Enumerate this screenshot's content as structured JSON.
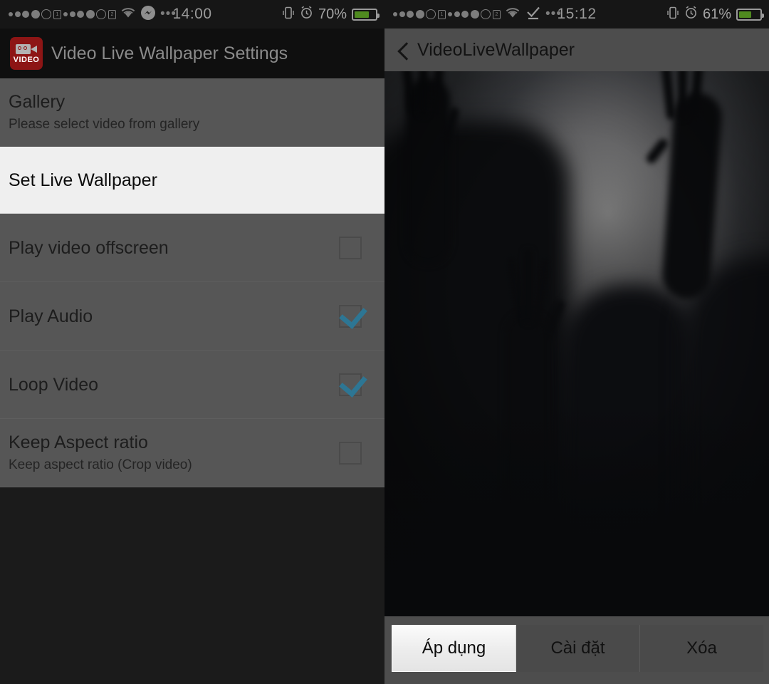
{
  "colors": {
    "status_bar_bg": "#161616",
    "app_header_bg": "#0f0f0f",
    "list_bg": "#565656",
    "highlight_row_bg": "#efefef",
    "checkbox_accent": "#2d7694",
    "app_icon_red": "#8d1515",
    "battery_green": "#4f8a1f",
    "preview_bar_bg": "#4d4d4d"
  },
  "left_screen": {
    "status_bar": {
      "clock": "14:00",
      "battery_percent": "70%",
      "battery_level": 70,
      "icons": [
        "signal-dots-sim1",
        "sim1-badge",
        "signal-dots-sim2",
        "sim2-badge",
        "wifi-icon",
        "messenger-icon",
        "more-icon",
        "vibrate-icon",
        "alarm-icon",
        "battery-icon"
      ],
      "sim1_label": "1",
      "sim2_label": "2"
    },
    "app_header": {
      "icon_label": "VIDEO",
      "title": "Video Live Wallpaper Settings"
    },
    "rows": [
      {
        "title": "Gallery",
        "subtitle": "Please select video from gallery",
        "has_checkbox": false,
        "checked": false,
        "highlighted": false
      },
      {
        "title": "Set Live Wallpaper",
        "subtitle": "",
        "has_checkbox": false,
        "checked": false,
        "highlighted": true
      },
      {
        "title": "Play video offscreen",
        "subtitle": "",
        "has_checkbox": true,
        "checked": false,
        "highlighted": false
      },
      {
        "title": "Play Audio",
        "subtitle": "",
        "has_checkbox": true,
        "checked": true,
        "highlighted": false
      },
      {
        "title": "Loop Video",
        "subtitle": "",
        "has_checkbox": true,
        "checked": true,
        "highlighted": false
      },
      {
        "title": "Keep Aspect ratio",
        "subtitle": "Keep aspect ratio (Crop video)",
        "has_checkbox": true,
        "checked": false,
        "highlighted": false
      }
    ]
  },
  "right_screen": {
    "status_bar": {
      "clock": "15:12",
      "battery_percent": "61%",
      "battery_level": 61,
      "icons": [
        "signal-dots-sim1",
        "sim1-badge",
        "signal-dots-sim2",
        "sim2-badge",
        "wifi-icon",
        "download-complete-icon",
        "more-icon",
        "vibrate-icon",
        "alarm-icon",
        "battery-icon"
      ],
      "sim1_label": "1",
      "sim2_label": "2"
    },
    "header": {
      "back_label": "back-icon",
      "title": "VideoLiveWallpaper"
    },
    "preview": {
      "description": "Dark blurred silhouettes of hands and figures behind frosted glass"
    },
    "buttons": [
      {
        "label": "Áp dụng",
        "active": true
      },
      {
        "label": "Cài đặt",
        "active": false
      },
      {
        "label": "Xóa",
        "active": false
      }
    ]
  }
}
